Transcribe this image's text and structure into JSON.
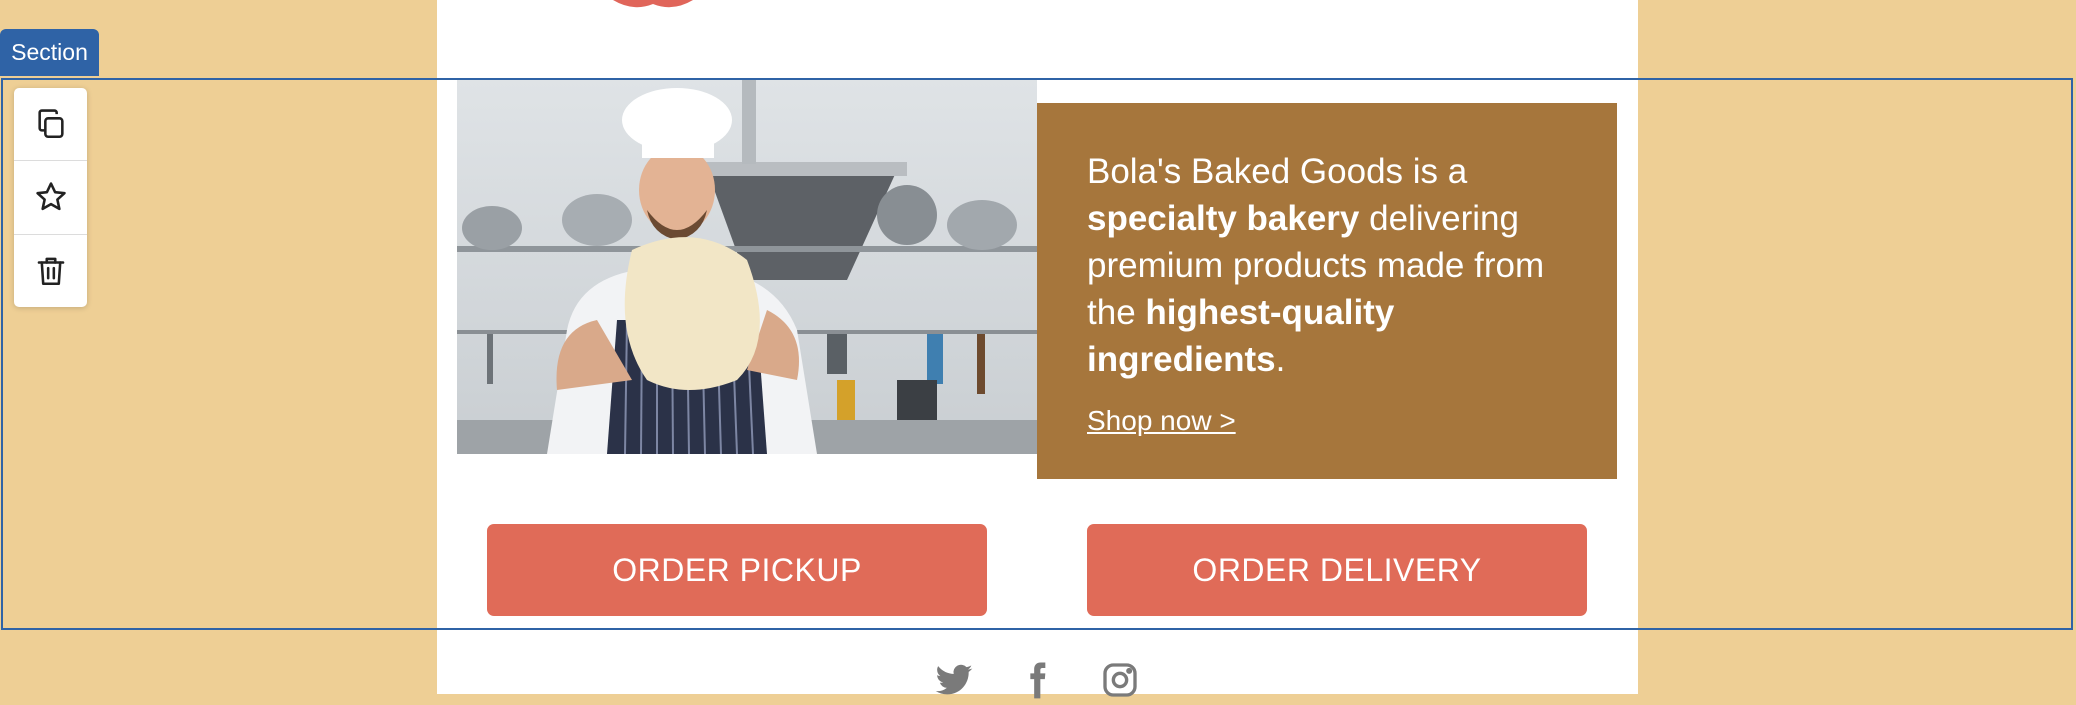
{
  "editor": {
    "section_label": "Section",
    "toolbar": [
      {
        "name": "duplicate-icon"
      },
      {
        "name": "star-icon"
      },
      {
        "name": "trash-icon"
      }
    ]
  },
  "hero": {
    "text_part1": "Bola's Baked Goods is a ",
    "text_bold1": "specialty bakery",
    "text_part2": " delivering premium products made from the ",
    "text_bold2": "highest-quality ingredients",
    "text_part3": ".",
    "link_label": "Shop now >"
  },
  "buttons": {
    "pickup": "ORDER PICKUP",
    "delivery": "ORDER DELIVERY"
  },
  "social": [
    "twitter-icon",
    "facebook-icon",
    "instagram-icon"
  ],
  "colors": {
    "background": "#eecf95",
    "accent_blue": "#2f63a6",
    "hero_box": "#a6763c",
    "button": "#e06b58"
  }
}
